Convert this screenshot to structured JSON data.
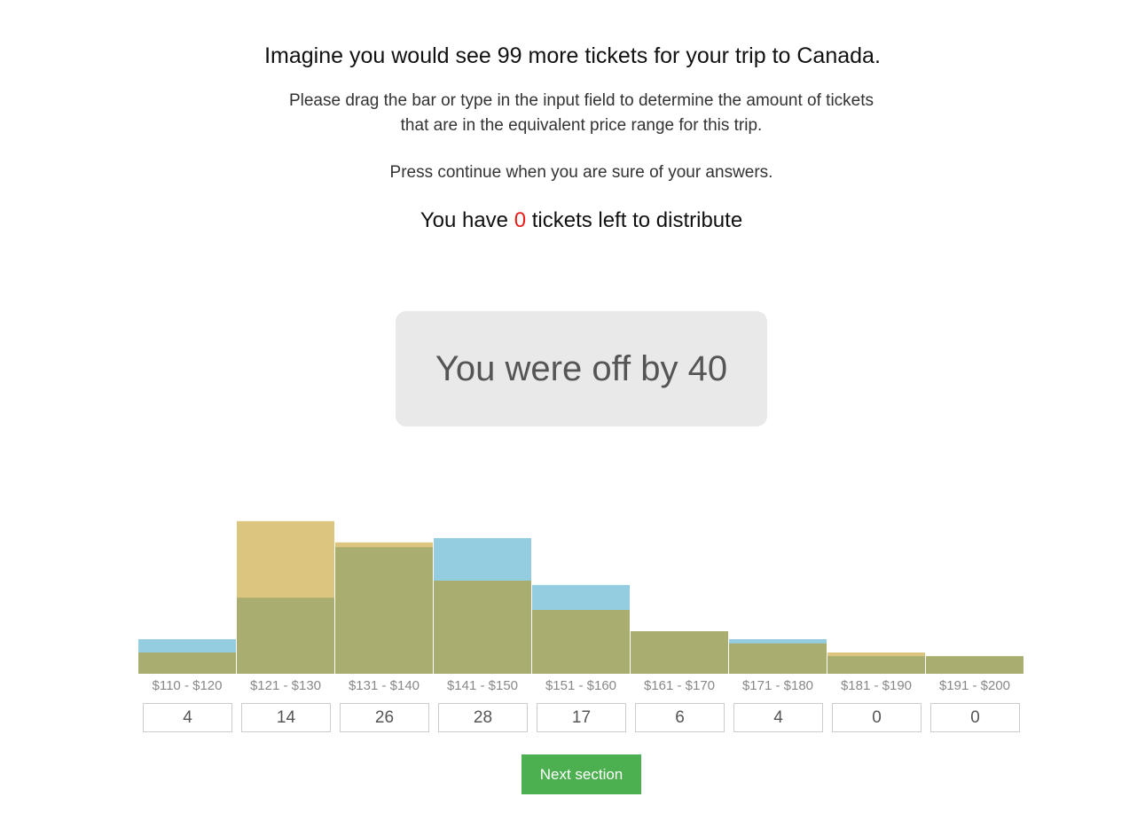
{
  "header": {
    "title": "Imagine you would see 99 more tickets for your trip to Canada.",
    "instruction_line1": "Please drag the bar or type in the input field to determine the amount of tickets",
    "instruction_line2": "that are in the equivalent price range for this trip.",
    "press_continue": "Press continue when you are sure of your answers.",
    "remaining_prefix": "You have ",
    "remaining_count": "0",
    "remaining_suffix": " tickets left to distribute"
  },
  "result": {
    "text": "You were off by 40"
  },
  "colors": {
    "actual_blue": "#95cde0",
    "guess_gold": "#dbc57f",
    "overlap_olive": "#a9ae70",
    "remaining_red": "#e8201a",
    "button_green": "#4caf50",
    "result_bg": "#e9e9e9"
  },
  "chart_data": {
    "type": "bar",
    "title": "",
    "xlabel": "",
    "ylabel": "",
    "categories": [
      "$110 - $120",
      "$121 - $130",
      "$131 - $140",
      "$141 - $150",
      "$151 - $160",
      "$161 - $170",
      "$171 - $180",
      "$181 - $190",
      "$191 - $200"
    ],
    "series": [
      {
        "name": "blue",
        "color": "#95cde0",
        "values": [
          6.5,
          14.3,
          23.8,
          25.5,
          16.7,
          8,
          6.5,
          3.3,
          3.3
        ]
      },
      {
        "name": "gold",
        "color": "#dbc57f",
        "values": [
          4,
          28.7,
          24.7,
          17.5,
          12,
          8,
          5.7,
          4,
          3.3
        ]
      }
    ],
    "overlay": true,
    "overlap_color": "#a9ae70",
    "ylim": [
      0,
      30
    ],
    "grid": false,
    "input_values": [
      "4",
      "14",
      "26",
      "28",
      "17",
      "6",
      "4",
      "0",
      "0"
    ]
  },
  "button": {
    "next_label": "Next section"
  }
}
